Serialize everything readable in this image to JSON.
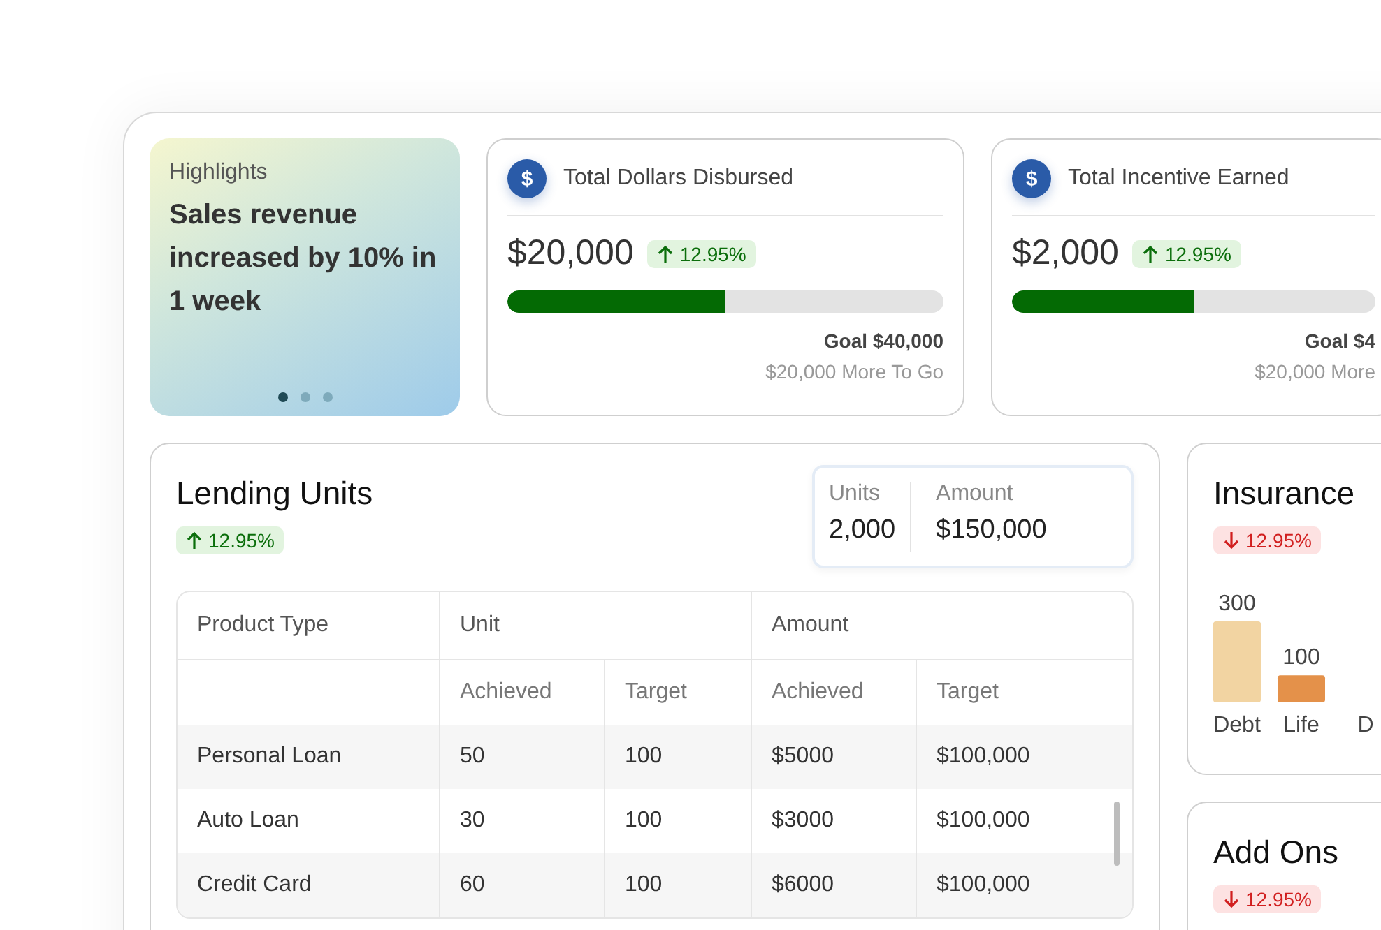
{
  "highlight": {
    "label": "Highlights",
    "message": "Sales revenue increased by 10% in 1 week",
    "dots": [
      {
        "selected": true
      },
      {
        "selected": false
      },
      {
        "selected": false
      }
    ]
  },
  "stat_cards": [
    {
      "icon": "$",
      "title": "Total Dollars Disbursed",
      "value": "$20,000",
      "change": {
        "text": "12.95%",
        "kind": "up"
      },
      "level": 0.5,
      "goal": "Goal $40,000",
      "remaining": "$20,000 More To Go"
    },
    {
      "icon": "$",
      "title": "Total Incentive Earned",
      "value": "$2,000",
      "change": {
        "text": "12.95%",
        "kind": "up"
      },
      "level": 0.5,
      "goal": "Goal $4",
      "remaining": "$20,000 More"
    }
  ],
  "lending_units": {
    "title": "Lending Units",
    "change": {
      "text": "12.95%",
      "kind": "up"
    },
    "summary": [
      {
        "label": "Units",
        "value": "2,000"
      },
      {
        "label": "Amount",
        "value": "$150,000"
      }
    ],
    "table": {
      "groups": [
        "Product Type",
        "Unit",
        "Amount"
      ],
      "subcolumns": [
        "Achieved",
        "Target",
        "Achieved",
        "Target"
      ],
      "rows": [
        [
          "Personal Loan",
          "50",
          "100",
          "$5000",
          "$100,000"
        ],
        [
          "Auto Loan",
          "30",
          "100",
          "$3000",
          "$100,000"
        ],
        [
          "Credit Card",
          "60",
          "100",
          "$6000",
          "$100,000"
        ]
      ]
    }
  },
  "insurance": {
    "title": "Insurance",
    "change": {
      "text": "12.95%",
      "kind": "down"
    },
    "chart_data": {
      "type": "bar",
      "categories": [
        "Debt",
        "Life",
        "D"
      ],
      "colors": [
        "#f2d4a2",
        "#e4914a"
      ],
      "series": [
        {
          "values": [
            300,
            100,
            null
          ]
        }
      ],
      "data_labels": true
    }
  },
  "add_ons": {
    "title": "Add Ons",
    "change": {
      "text": "12.95%",
      "kind": "down"
    }
  }
}
